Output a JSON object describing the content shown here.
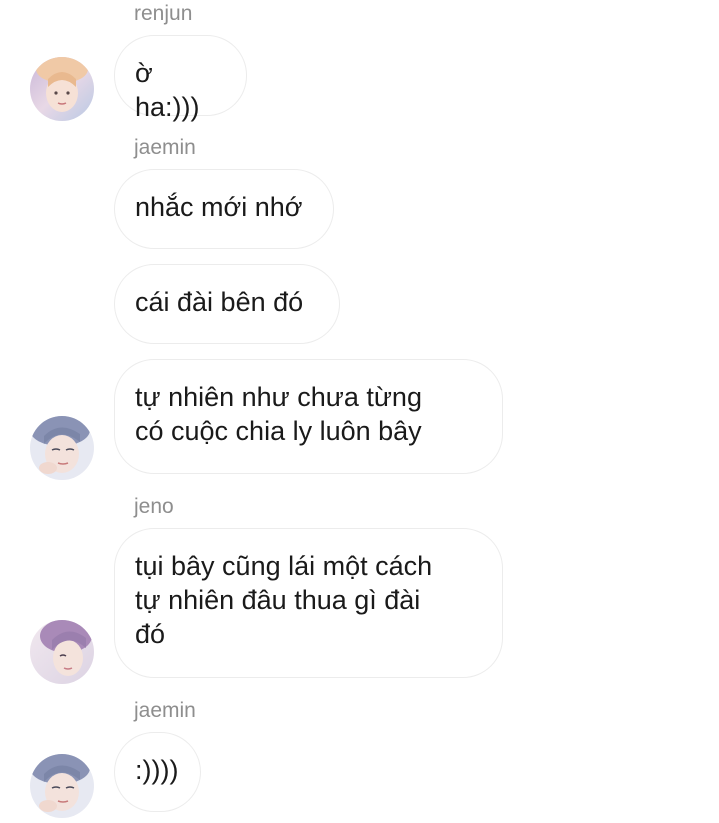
{
  "messages": [
    {
      "sender": "renjun",
      "bubbles": [
        "ờ ha:)))"
      ]
    },
    {
      "sender": "jaemin",
      "bubbles": [
        "nhắc mới nhớ",
        "cái đài bên đó",
        "tự nhiên như chưa từng\ncó cuộc chia ly luôn bây"
      ]
    },
    {
      "sender": "jeno",
      "bubbles": [
        "tụi bây cũng lái một cách\ntự nhiên đâu thua gì đài\nđó"
      ]
    },
    {
      "sender": "jaemin",
      "bubbles": [
        ":))))"
      ]
    }
  ],
  "colors": {
    "bubble_border": "#ececec",
    "sender_text": "#8e8e8e",
    "message_text": "#1a1a1a"
  }
}
